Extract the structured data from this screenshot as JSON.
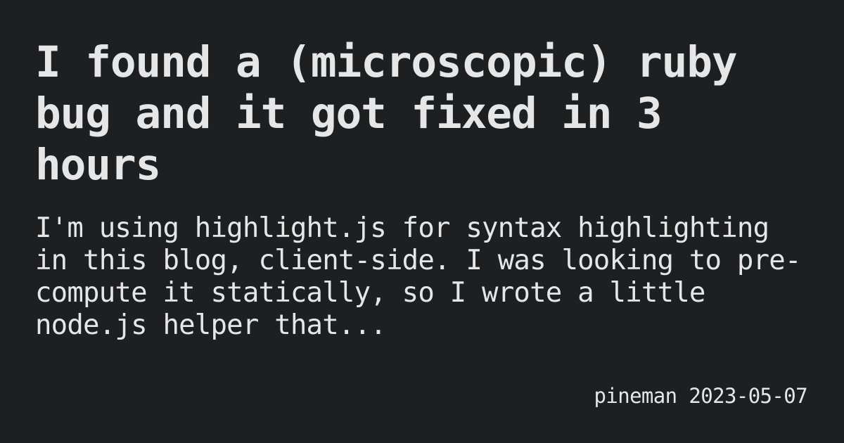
{
  "post": {
    "title": "I found a (microscopic) ruby bug and it got fixed in 3 hours",
    "excerpt": "I'm using highlight.js for syntax highlighting in this blog, client-side. I was looking to pre-compute it statically, so I wrote a little node.js helper that...",
    "author": "pineman",
    "date": "2023-05-07"
  },
  "colors": {
    "background": "#1e1f21",
    "text": "#e6e6e6"
  }
}
